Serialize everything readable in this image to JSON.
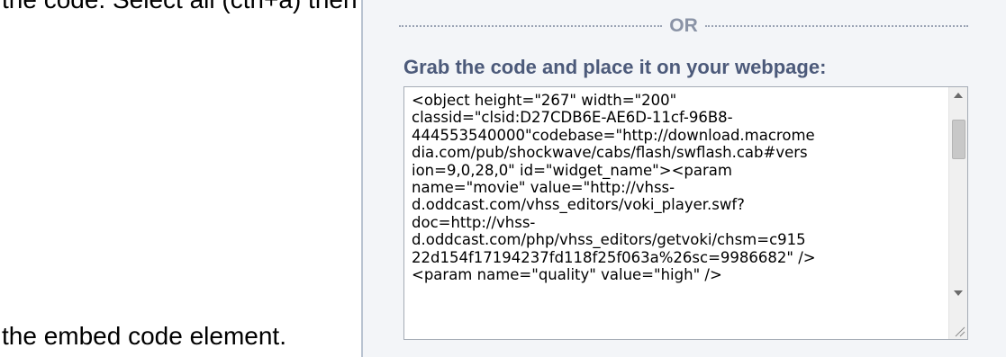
{
  "document": {
    "top_line": "the code. Select all (ctrl+a) then copy and paste the code in your Weebly web",
    "bottom_line": "the embed code element."
  },
  "panel": {
    "separator_text": "OR",
    "heading": "Grab the code and place it on your webpage:",
    "code_lines": [
      "<object height=\"267\" width=\"200\"",
      "classid=\"clsid:D27CDB6E-AE6D-11cf-96B8-",
      "444553540000\"codebase=\"http://download.macrome",
      "dia.com/pub/shockwave/cabs/flash/swflash.cab#vers",
      "ion=9,0,28,0\" id=\"widget_name\"><param",
      "name=\"movie\" value=\"http://vhss-",
      "d.oddcast.com/vhss_editors/voki_player.swf?",
      "doc=http://vhss-",
      "d.oddcast.com/php/vhss_editors/getvoki/chsm=c915",
      "22d154f17194237fd118f25f063a%26sc=9986682\" />",
      "<param name=\"quality\" value=\"high\" />"
    ],
    "scroll_position": 0.12
  },
  "icons": {
    "scroll_up": "triangle-up-icon",
    "scroll_down": "triangle-down-icon",
    "resize": "resize-grip-icon"
  },
  "colors": {
    "panel_bg": "#f3f5f8",
    "heading": "#4c5a7a",
    "separator": "#8a93a6",
    "panel_border": "#b9c3d1"
  }
}
